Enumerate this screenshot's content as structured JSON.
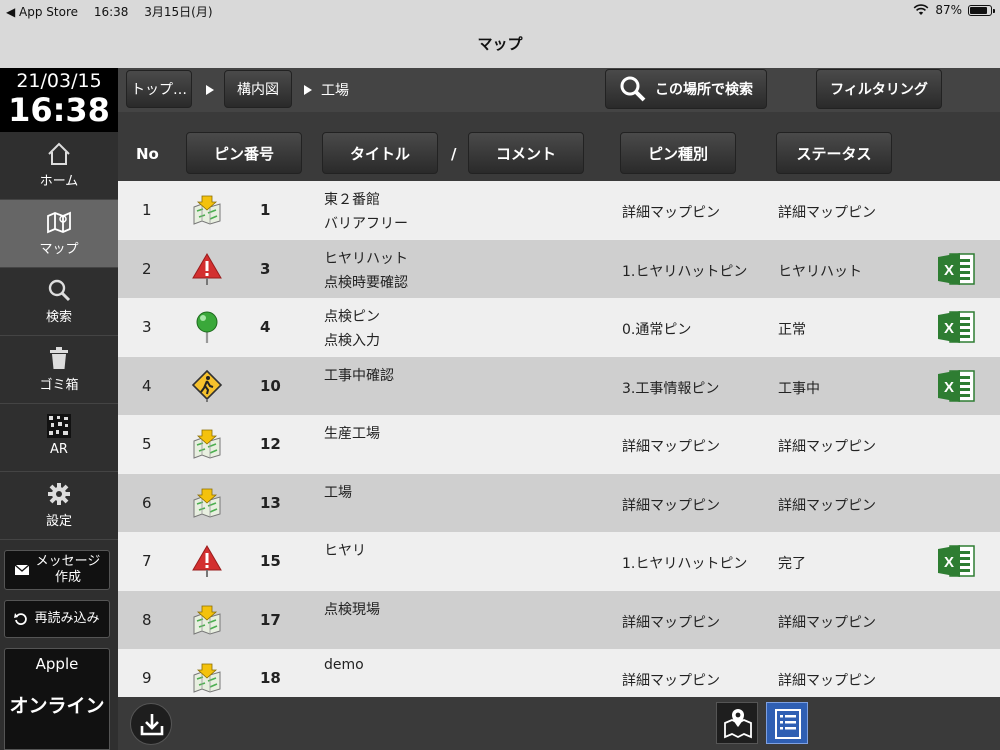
{
  "status_bar": {
    "back_app": "◀ App Store",
    "time": "16:38",
    "date": "3月15日(月)",
    "battery": "87%",
    "battery_level": 0.87
  },
  "nav_title": "マップ",
  "clock": {
    "date": "21/03/15",
    "time": "16:38"
  },
  "sidebar": {
    "items": [
      {
        "label": "ホーム",
        "icon": "home-icon"
      },
      {
        "label": "マップ",
        "icon": "map-icon",
        "active": true
      },
      {
        "label": "検索",
        "icon": "search-icon"
      },
      {
        "label": "ゴミ箱",
        "icon": "trash-icon"
      },
      {
        "label": "AR",
        "icon": "ar-marker-icon"
      },
      {
        "label": "設定",
        "icon": "gear-icon"
      }
    ],
    "message_button": "メッセージ\n作成",
    "reload_button": "再読み込み",
    "user": "Apple",
    "online_status": "オンライン"
  },
  "breadcrumb": {
    "top": "トップ…",
    "level2": "構内図",
    "current": "工場"
  },
  "toolbar": {
    "search_here": "この場所で検索",
    "filtering": "フィルタリング"
  },
  "columns": {
    "no": "No",
    "pin_no": "ピン番号",
    "title": "タイトル",
    "separator": "/",
    "comment": "コメント",
    "pin_type": "ピン種別",
    "status": "ステータス"
  },
  "rows": [
    {
      "no": "1",
      "icon": "detail-map-pin-icon",
      "pin": "1",
      "title": "東２番館",
      "comment": "バリアフリー",
      "type": "詳細マップピン",
      "status": "詳細マップピン",
      "excel": false
    },
    {
      "no": "2",
      "icon": "warning-pin-icon",
      "pin": "3",
      "title": "ヒヤリハット",
      "comment": "点検時要確認",
      "type": "1.ヒヤリハットピン",
      "status": "ヒヤリハット",
      "excel": true
    },
    {
      "no": "3",
      "icon": "green-pin-icon",
      "pin": "4",
      "title": "点検ピン",
      "comment": "点検入力",
      "type": "0.通常ピン",
      "status": "正常",
      "excel": true
    },
    {
      "no": "4",
      "icon": "construction-pin-icon",
      "pin": "10",
      "title": "工事中確認",
      "comment": "",
      "type": "3.工事情報ピン",
      "status": "工事中",
      "excel": true
    },
    {
      "no": "5",
      "icon": "detail-map-pin-icon",
      "pin": "12",
      "title": "生産工場",
      "comment": "",
      "type": "詳細マップピン",
      "status": "詳細マップピン",
      "excel": false
    },
    {
      "no": "6",
      "icon": "detail-map-pin-icon",
      "pin": "13",
      "title": "工場",
      "comment": "",
      "type": "詳細マップピン",
      "status": "詳細マップピン",
      "excel": false
    },
    {
      "no": "7",
      "icon": "warning-pin-icon",
      "pin": "15",
      "title": "ヒヤリ",
      "comment": "",
      "type": "1.ヒヤリハットピン",
      "status": "完了",
      "excel": true
    },
    {
      "no": "8",
      "icon": "detail-map-pin-icon",
      "pin": "17",
      "title": "点検現場",
      "comment": "",
      "type": "詳細マップピン",
      "status": "詳細マップピン",
      "excel": false
    },
    {
      "no": "9",
      "icon": "detail-map-pin-icon",
      "pin": "18",
      "title": "demo",
      "comment": "",
      "type": "詳細マップピン",
      "status": "詳細マップピン",
      "excel": false
    }
  ],
  "colors": {
    "sidebar": "#2f2f2f",
    "active": "#666666",
    "row_even": "#cfcfcf",
    "row_odd": "#efefef",
    "excel_green": "#2e7d32",
    "list_view_blue": "#2f5fb3"
  }
}
